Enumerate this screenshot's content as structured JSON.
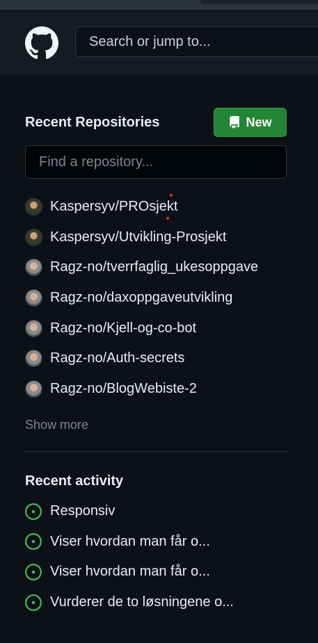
{
  "header": {
    "logo_icon": "github-octocat-icon",
    "search_placeholder": "Search or jump to..."
  },
  "repositories": {
    "title": "Recent Repositories",
    "new_button_label": "New",
    "new_button_icon": "repo-icon",
    "find_placeholder": "Find a repository...",
    "items": [
      {
        "name": "Kaspersyv/PROsjekt"
      },
      {
        "name": "Kaspersyv/Utvikling-Prosjekt"
      },
      {
        "name": "Ragz-no/tverrfaglig_ukesoppgave"
      },
      {
        "name": "Ragz-no/daxoppgaveutvikling"
      },
      {
        "name": "Ragz-no/Kjell-og-co-bot"
      },
      {
        "name": "Ragz-no/Auth-secrets"
      },
      {
        "name": "Ragz-no/BlogWebiste-2"
      }
    ],
    "show_more": "Show more"
  },
  "activity": {
    "title": "Recent activity",
    "icon": "issue-opened-icon",
    "items": [
      {
        "text": "Responsiv"
      },
      {
        "text": "Viser hvordan man får o..."
      },
      {
        "text": "Viser hvordan man får o..."
      },
      {
        "text": "Vurderer de to løsningene o..."
      }
    ]
  },
  "colors": {
    "background": "#0d1117",
    "header": "#161b22",
    "new_button": "#238636",
    "issue_open": "#3fb950"
  }
}
